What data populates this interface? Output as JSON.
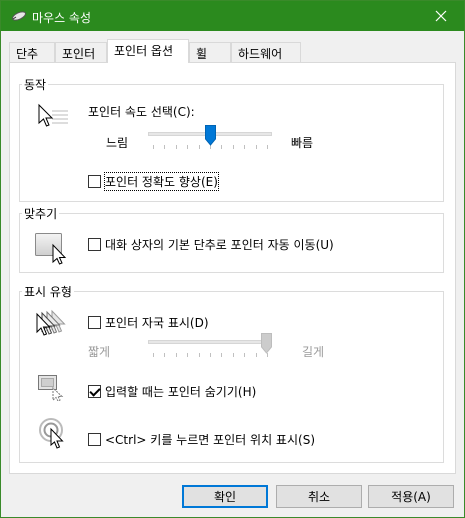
{
  "window": {
    "title": "마우스 속성",
    "accent": "#2b8a1e"
  },
  "tabs": [
    {
      "label": "단추",
      "active": false
    },
    {
      "label": "포인터",
      "active": false
    },
    {
      "label": "포인터 옵션",
      "active": true
    },
    {
      "label": "휠",
      "active": false
    },
    {
      "label": "하드웨어",
      "active": false
    }
  ],
  "motion": {
    "group_label": "동작",
    "speed_label": "포인터 속도 선택(C):",
    "slow_label": "느림",
    "fast_label": "빠름",
    "speed_level": 0.5,
    "precision_label": "포인터 정확도 향상(E)",
    "precision_checked": false
  },
  "snap": {
    "group_label": "맞추기",
    "snap_label": "대화 상자의 기본 단추로 포인터 자동 이동(U)",
    "snap_checked": false
  },
  "visibility": {
    "group_label": "표시 유형",
    "trails_label": "포인터 자국 표시(D)",
    "trails_checked": false,
    "short_label": "짧게",
    "long_label": "길게",
    "trails_level": 1.0,
    "hide_label": "입력할 때는 포인터 숨기기(H)",
    "hide_checked": true,
    "ctrl_label": "<Ctrl> 키를 누르면 포인터 위치 표시(S)",
    "ctrl_checked": false
  },
  "buttons": {
    "ok": "확인",
    "cancel": "취소",
    "apply": "적용(A)"
  },
  "icons": [
    "mouse-icon",
    "close-icon",
    "pointer-speed-icon",
    "snap-to-icon",
    "pointer-trails-icon",
    "hide-pointer-icon",
    "pointer-location-icon"
  ]
}
